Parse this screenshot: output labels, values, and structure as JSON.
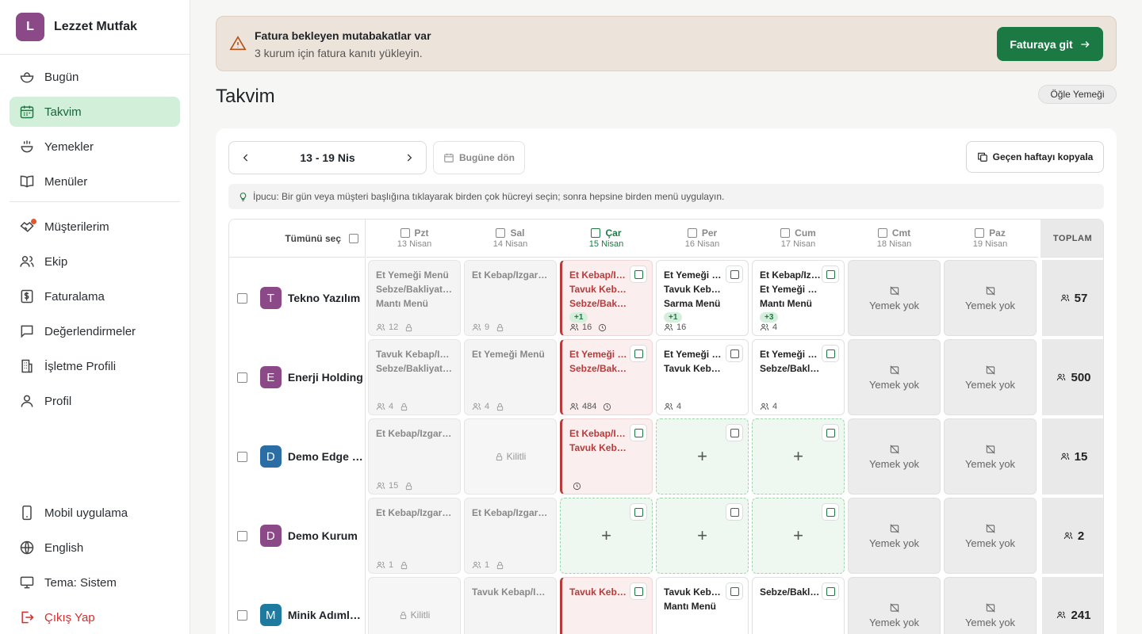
{
  "brand": {
    "initial": "L",
    "name": "Lezzet Mutfak"
  },
  "nav": {
    "today": "Bugün",
    "calendar": "Takvim",
    "meals": "Yemekler",
    "menus": "Menüler",
    "customers": "Müşterilerim",
    "team": "Ekip",
    "billing": "Faturalama",
    "reviews": "Değerlendirmeler",
    "business": "İşletme Profili",
    "profile": "Profil",
    "mobile": "Mobil uygulama",
    "language": "English",
    "theme": "Tema: Sistem",
    "logout": "Çıkış Yap"
  },
  "banner": {
    "title": "Fatura bekleyen mutabakatlar var",
    "subtitle": "3 kurum için fatura kanıtı yükleyin.",
    "button": "Faturaya git"
  },
  "page": {
    "title": "Takvim",
    "meal_type": "Öğle Yemeği"
  },
  "toolbar": {
    "week": "13 - 19 Nis",
    "today_btn": "Bugüne dön",
    "copy_btn": "Geçen haftayı kopyala"
  },
  "tip": "İpucu: Bir gün veya müşteri başlığına tıklayarak birden çok hücreyi seçin; sonra hepsine birden menü uygulayın.",
  "grid": {
    "select_all": "Tümünü seç",
    "total_label": "TOPLAM",
    "days": [
      {
        "name": "Pzt",
        "date": "13 Nisan"
      },
      {
        "name": "Sal",
        "date": "14 Nisan"
      },
      {
        "name": "Çar",
        "date": "15 Nisan"
      },
      {
        "name": "Per",
        "date": "16 Nisan"
      },
      {
        "name": "Cum",
        "date": "17 Nisan"
      },
      {
        "name": "Cmt",
        "date": "18 Nisan"
      },
      {
        "name": "Paz",
        "date": "19 Nisan"
      }
    ],
    "no_meal": "Yemek yok",
    "locked": "Kilitli",
    "rows": [
      {
        "initial": "T",
        "name": "Tekno Yazılım",
        "color": "#8b4a87",
        "total": "57",
        "cells": [
          {
            "lines": [
              "Et Yemeği Menü",
              "Sebze/Bakliyat Menü",
              "Mantı Menü"
            ],
            "count": "12"
          },
          {
            "lines": [
              "Et Kebap/Izgara Menü"
            ],
            "count": "9"
          },
          {
            "lines": [
              "Et Kebap/Izgara Menü",
              "Tavuk Kebap/Izgara Menü",
              "Sebze/Bakliyat Menü"
            ],
            "more": "+1",
            "count": "16"
          },
          {
            "lines": [
              "Et Yemeği Menü",
              "Tavuk Kebap/Izgara Menü",
              "Sarma Menü"
            ],
            "more": "+1",
            "count": "16"
          },
          {
            "lines": [
              "Et Kebap/Izgara Menü",
              "Et Yemeği Menü",
              "Mantı Menü"
            ],
            "more": "+3",
            "count": "4"
          }
        ]
      },
      {
        "initial": "E",
        "name": "Enerji Holding",
        "color": "#8b4a87",
        "total": "500",
        "cells": [
          {
            "lines": [
              "Tavuk Kebap/Izgara Menü",
              "Sebze/Bakliyat Menü"
            ],
            "count": "4"
          },
          {
            "lines": [
              "Et Yemeği Menü"
            ],
            "count": "4"
          },
          {
            "lines": [
              "Et Yemeği Menü",
              "Sebze/Bakliyat Menü"
            ],
            "count": "484"
          },
          {
            "lines": [
              "Et Yemeği Menü",
              "Tavuk Kebap/Izgara Menü"
            ],
            "count": "4"
          },
          {
            "lines": [
              "Et Yemeği Menü",
              "Sebze/Bakliyat Menü"
            ],
            "count": "4"
          }
        ]
      },
      {
        "initial": "D",
        "name": "Demo Edge Kurumu",
        "color": "#2b6ea5",
        "total": "15",
        "cells": [
          {
            "lines": [
              "Et Kebap/Izgara Menü"
            ],
            "count": "15"
          },
          {},
          {
            "lines": [
              "Et Kebap/Izgara Menü",
              "Tavuk Kebap/Izgara Menü"
            ]
          }
        ]
      },
      {
        "initial": "D",
        "name": "Demo Kurum",
        "color": "#8b4a87",
        "total": "2",
        "cells": [
          {
            "lines": [
              "Et Kebap/Izgara Menü"
            ],
            "count": "1"
          },
          {
            "lines": [
              "Et Kebap/Izgara Menü"
            ],
            "count": "1"
          }
        ]
      },
      {
        "initial": "M",
        "name": "Minik Adımlar Kreş",
        "color": "#1f7aa0",
        "total": "241",
        "cells": [
          {},
          {
            "lines": [
              "Tavuk Kebap/Izgara Menü"
            ]
          },
          {
            "lines": [
              "Tavuk Kebap/Izgara Menü"
            ]
          },
          {
            "lines": [
              "Tavuk Kebap/Izgara Menü",
              "Mantı Menü"
            ]
          },
          {
            "lines": [
              "Sebze/Bakliyat Menü"
            ]
          }
        ]
      }
    ]
  }
}
